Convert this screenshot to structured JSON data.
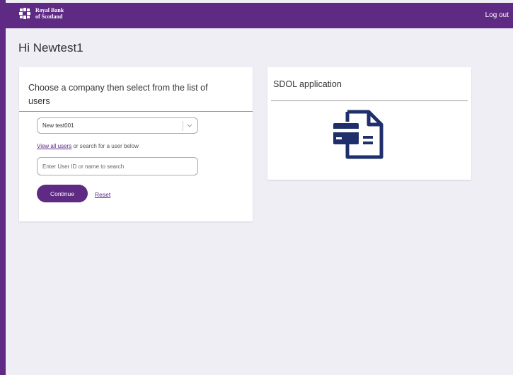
{
  "header": {
    "brand_line1": "Royal Bank",
    "brand_line2": "of Scotland",
    "logout_label": "Log out",
    "color": "#5e2a84"
  },
  "greeting": "Hi Newtest1",
  "company_card": {
    "title": "Choose a company then select from the list of users",
    "selected_company": "New test001",
    "view_all_label": "View all users",
    "search_hint": " or search for a user below",
    "search_placeholder": "Enter User ID or name to search",
    "continue_label": "Continue",
    "reset_label": "Reset"
  },
  "sdol_card": {
    "title": "SDOL application",
    "icon": "document-card-icon"
  }
}
